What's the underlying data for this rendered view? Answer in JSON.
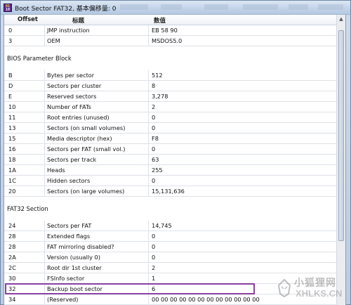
{
  "window": {
    "title": "Boot Sector FAT32, 基本偏移量: 0"
  },
  "columns": {
    "offset": "Offset",
    "name": "标题",
    "value": "数值"
  },
  "groups": [
    {
      "title": "",
      "rows": [
        {
          "offset": "0",
          "name": "JMP instruction",
          "value": "EB 58 90"
        },
        {
          "offset": "3",
          "name": "OEM",
          "value": "MSDOS5.0"
        }
      ]
    },
    {
      "title": "BIOS Parameter Block",
      "rows": [
        {
          "offset": "B",
          "name": "Bytes per sector",
          "value": "512"
        },
        {
          "offset": "D",
          "name": "Sectors per cluster",
          "value": "8"
        },
        {
          "offset": "E",
          "name": "Reserved sectors",
          "value": "3,278"
        },
        {
          "offset": "10",
          "name": "Number of FATs",
          "value": "2"
        },
        {
          "offset": "11",
          "name": "Root entries (unused)",
          "value": "0"
        },
        {
          "offset": "13",
          "name": "Sectors (on small volumes)",
          "value": "0"
        },
        {
          "offset": "15",
          "name": "Media descriptor (hex)",
          "value": "F8"
        },
        {
          "offset": "16",
          "name": "Sectors per FAT (small vol.)",
          "value": "0"
        },
        {
          "offset": "18",
          "name": "Sectors per track",
          "value": "63"
        },
        {
          "offset": "1A",
          "name": "Heads",
          "value": "255"
        },
        {
          "offset": "1C",
          "name": "Hidden sectors",
          "value": "0"
        },
        {
          "offset": "20",
          "name": "Sectors (on large volumes)",
          "value": "15,131,636"
        }
      ]
    },
    {
      "title": "FAT32 Section",
      "rows": [
        {
          "offset": "24",
          "name": "Sectors per FAT",
          "value": "14,745"
        },
        {
          "offset": "28",
          "name": "Extended flags",
          "value": "0"
        },
        {
          "offset": "28",
          "name": "FAT mirroring disabled?",
          "value": "0"
        },
        {
          "offset": "2A",
          "name": "Version (usually 0)",
          "value": "0"
        },
        {
          "offset": "2C",
          "name": "Root dir 1st cluster",
          "value": "2"
        },
        {
          "offset": "30",
          "name": "FSInfo sector",
          "value": "1"
        },
        {
          "offset": "32",
          "name": "Backup boot sector",
          "value": "6",
          "highlighted": true
        },
        {
          "offset": "34",
          "name": "(Reserved)",
          "value": "00 00 00 00 00 00 00 00 00 00 00 00"
        }
      ]
    }
  ],
  "watermark": {
    "cn": "小狐狸网",
    "en": "XHLKS.CN"
  },
  "colors": {
    "highlight": "#8b3fa3",
    "titlebar": "#c5d6ea"
  },
  "icons": {
    "app": "hex-editor-icon",
    "scroll_up": "scroll-up-arrow-icon"
  }
}
